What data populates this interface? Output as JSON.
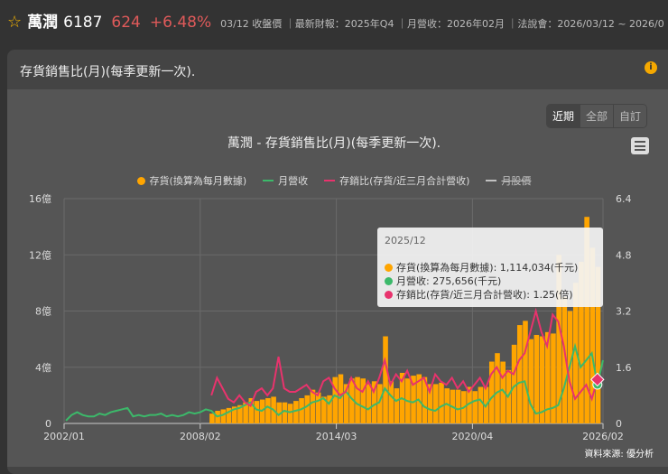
{
  "header": {
    "name": "萬潤",
    "code": "6187",
    "price": "624",
    "change": "+6.48%",
    "meta": "03/12 收盤價 ｜最新財報：2025年Q4 ｜月營收：2026年02月 ｜法說會：2026/03/12 ~ 2026/0"
  },
  "panel": {
    "title": "存貨銷售比(月)(每季更新一次)."
  },
  "range": [
    "近期",
    "全部",
    "自訂"
  ],
  "chart_data": {
    "type": "bar+line",
    "title": "萬潤 - 存貨銷售比(月)(每季更新一次).",
    "legend": [
      "存貨(換算為每月數據)",
      "月營收",
      "存銷比(存貨/近三月合計營收)",
      "月股價"
    ],
    "left_ticks": [
      "0",
      "4億",
      "8億",
      "12億",
      "16億"
    ],
    "right_ticks": [
      "0",
      "1.6",
      "3.2",
      "4.8",
      "6.4"
    ],
    "ylim_left": [
      0,
      16
    ],
    "ylim_right": [
      0,
      6.4
    ],
    "x_ticks": [
      "2002/01",
      "2008/02",
      "2014/03",
      "2020/04",
      "2026/02"
    ],
    "inventory_start": "2008Q3",
    "inventory_yi": [
      0.7,
      0.9,
      1.0,
      1.1,
      1.2,
      1.3,
      1.5,
      1.8,
      1.6,
      1.7,
      1.8,
      1.9,
      1.5,
      1.5,
      1.4,
      1.6,
      1.8,
      2.0,
      2.4,
      2.2,
      1.9,
      2.0,
      3.3,
      3.5,
      2.8,
      3.2,
      3.3,
      3.2,
      2.8,
      3.0,
      2.8,
      6.2,
      3.0,
      2.5,
      3.6,
      3.2,
      3.4,
      3.5,
      3.3,
      2.8,
      2.8,
      2.9,
      2.5,
      2.4,
      2.4,
      2.3,
      2.6,
      2.3,
      2.6,
      2.6,
      4.4,
      5.0,
      4.4,
      3.8,
      5.6,
      7.0,
      7.3,
      6.0,
      6.3,
      6.2,
      6.5,
      6.4,
      12.0,
      9.0,
      8.0,
      10.0,
      11.5,
      14.7,
      12.5,
      11.14
    ],
    "revenue_start": "2002Q1",
    "revenue_yi": [
      0.2,
      0.6,
      0.8,
      0.6,
      0.5,
      0.5,
      0.7,
      0.6,
      0.8,
      0.9,
      1.0,
      1.1,
      0.5,
      0.6,
      0.5,
      0.6,
      0.6,
      0.7,
      0.5,
      0.6,
      0.5,
      0.6,
      0.8,
      0.7,
      0.8,
      1.0,
      0.9,
      0.5,
      0.6,
      0.8,
      1.0,
      1.1,
      1.3,
      1.5,
      1.0,
      0.9,
      1.2,
      1.0,
      0.6,
      0.9,
      0.8,
      0.9,
      1.0,
      1.2,
      1.5,
      1.6,
      1.8,
      1.4,
      2.0,
      1.8,
      2.3,
      1.8,
      1.4,
      1.2,
      1.0,
      1.3,
      1.5,
      2.5,
      2.0,
      1.6,
      1.8,
      1.6,
      1.5,
      1.7,
      1.2,
      1.0,
      0.9,
      1.2,
      1.4,
      1.2,
      1.0,
      1.1,
      1.4,
      1.6,
      1.7,
      1.2,
      1.8,
      2.2,
      2.4,
      1.9,
      2.6,
      2.9,
      3.0,
      1.4,
      0.7,
      0.8,
      1.0,
      1.1,
      1.3,
      2.5,
      4.0,
      5.5,
      4.0,
      4.5,
      5.0,
      2.76,
      4.5
    ],
    "ratio_start": "2008Q3",
    "ratio": [
      0.8,
      1.3,
      1.0,
      0.7,
      0.6,
      0.8,
      0.6,
      0.5,
      0.9,
      1.0,
      0.8,
      1.0,
      1.9,
      1.0,
      0.9,
      0.9,
      1.0,
      1.1,
      0.9,
      0.8,
      1.2,
      1.3,
      1.0,
      0.8,
      0.9,
      1.3,
      1.0,
      0.9,
      1.2,
      0.9,
      1.3,
      1.8,
      1.1,
      1.4,
      1.2,
      1.5,
      1.1,
      1.2,
      1.3,
      0.9,
      1.4,
      1.2,
      1.1,
      1.3,
      1.0,
      1.2,
      0.9,
      1.1,
      1.3,
      1.0,
      1.4,
      1.6,
      1.3,
      1.5,
      1.4,
      1.8,
      2.0,
      2.6,
      3.2,
      2.6,
      2.2,
      3.1,
      2.9,
      2.2,
      1.2,
      0.7,
      0.9,
      1.1,
      0.7,
      1.25
    ],
    "colors": {
      "inventory": "#ffa500",
      "revenue": "#3cb96a",
      "ratio": "#e8336d",
      "price": "#dddddd"
    }
  },
  "tooltip": {
    "date": "2025/12",
    "rows": [
      "存貨(換算為每月數據): 1,114,034(千元)",
      "月營收: 275,656(千元)",
      "存銷比(存貨/近三月合計營收): 1.25(倍)"
    ]
  },
  "source": "資料來源: 優分析"
}
